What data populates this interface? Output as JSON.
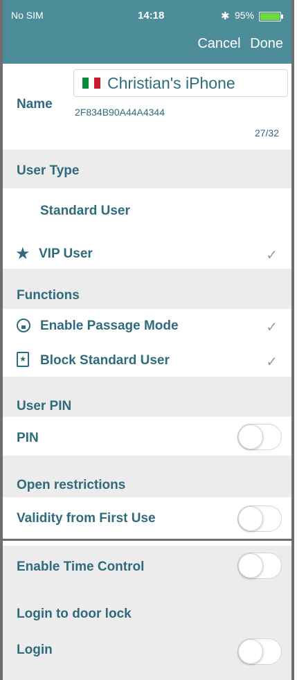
{
  "status_bar": {
    "carrier": "No SIM",
    "time": "14:18",
    "bluetooth_symbol": "✱",
    "battery_pct": "95%"
  },
  "nav": {
    "cancel": "Cancel",
    "done": "Done"
  },
  "name": {
    "label": "Name",
    "value": "Christian's iPhone",
    "device_id": "2F834B90A44A4344",
    "counter": "27/32"
  },
  "user_type": {
    "section": "User Type",
    "standard": "Standard User",
    "vip": "VIP User",
    "star_glyph": "★",
    "check_glyph": "✓"
  },
  "functions": {
    "section": "Functions",
    "passage": "Enable Passage Mode",
    "block": "Block Standard User",
    "block_glyph": "★"
  },
  "user_pin": {
    "section": "User PIN",
    "pin": "PIN"
  },
  "open_restrictions": {
    "section": "Open restrictions",
    "validity": "Validity from First Use",
    "time_control": "Enable Time Control"
  },
  "login": {
    "section": "Login to door lock",
    "login": "Login"
  },
  "colors": {
    "header": "#4c8d99",
    "text": "#2f6a7d",
    "section_bg": "#ececec",
    "battery": "#6bdc3b"
  }
}
